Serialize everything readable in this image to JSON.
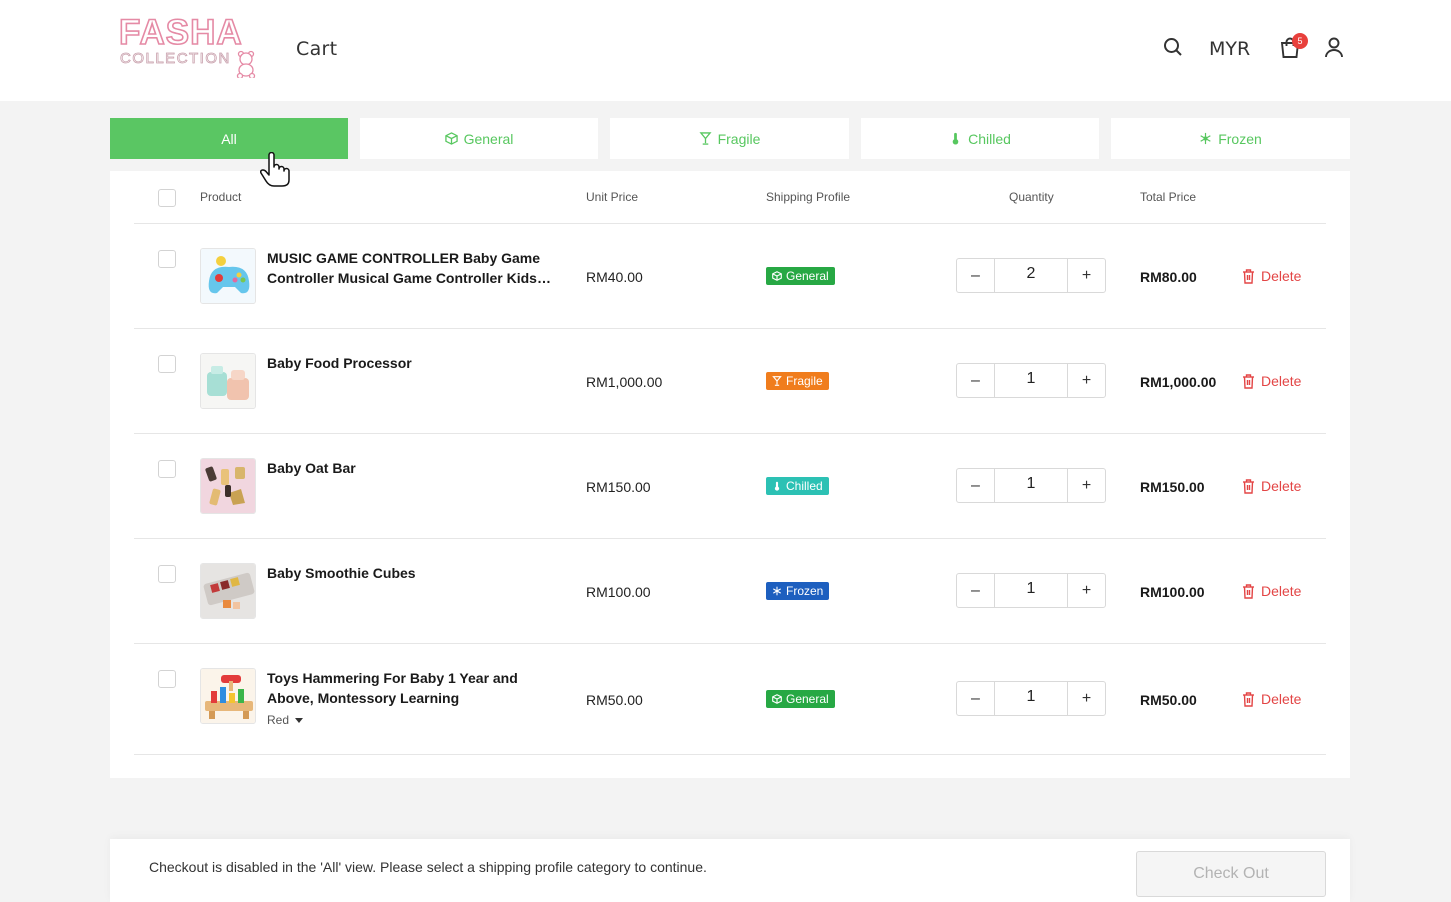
{
  "header": {
    "logo_top": "FASHA",
    "logo_bottom": "COLLECTION",
    "title": "Cart",
    "currency": "MYR",
    "cart_count": "5",
    "icons": [
      "search-icon",
      "cart-icon",
      "user-icon"
    ]
  },
  "tabs": [
    {
      "label": "All",
      "icon": "none",
      "active": true
    },
    {
      "label": "General",
      "icon": "box-icon",
      "active": false
    },
    {
      "label": "Fragile",
      "icon": "glass-icon",
      "active": false
    },
    {
      "label": "Chilled",
      "icon": "thermometer-icon",
      "active": false
    },
    {
      "label": "Frozen",
      "icon": "snowflake-icon",
      "active": false
    }
  ],
  "table": {
    "headers": {
      "product": "Product",
      "unit_price": "Unit Price",
      "shipping_profile": "Shipping Profile",
      "quantity": "Quantity",
      "total_price": "Total Price"
    },
    "delete_label": "Delete",
    "rows": [
      {
        "name": "MUSIC GAME CONTROLLER Baby Game Controller Musical Game Controller Kids…",
        "unit_price": "RM40.00",
        "profile": "General",
        "quantity": "2",
        "total": "RM80.00",
        "variant": ""
      },
      {
        "name": "Baby Food Processor",
        "unit_price": "RM1,000.00",
        "profile": "Fragile",
        "quantity": "1",
        "total": "RM1,000.00",
        "variant": ""
      },
      {
        "name": "Baby Oat Bar",
        "unit_price": "RM150.00",
        "profile": "Chilled",
        "quantity": "1",
        "total": "RM150.00",
        "variant": ""
      },
      {
        "name": "Baby Smoothie Cubes",
        "unit_price": "RM100.00",
        "profile": "Frozen",
        "quantity": "1",
        "total": "RM100.00",
        "variant": ""
      },
      {
        "name": "Toys Hammering For Baby 1 Year and Above, Montessory Learning",
        "unit_price": "RM50.00",
        "profile": "General",
        "quantity": "1",
        "total": "RM50.00",
        "variant": "Red"
      }
    ]
  },
  "profile_colors": {
    "General": "#27a844",
    "Fragile": "#f07d1d",
    "Chilled": "#2cc1b4",
    "Frozen": "#1d5fbf"
  },
  "accent_color": "#5ac663",
  "footer": {
    "message": "Checkout is disabled in the 'All' view. Please select a shipping profile category to continue.",
    "checkout_label": "Check Out"
  }
}
